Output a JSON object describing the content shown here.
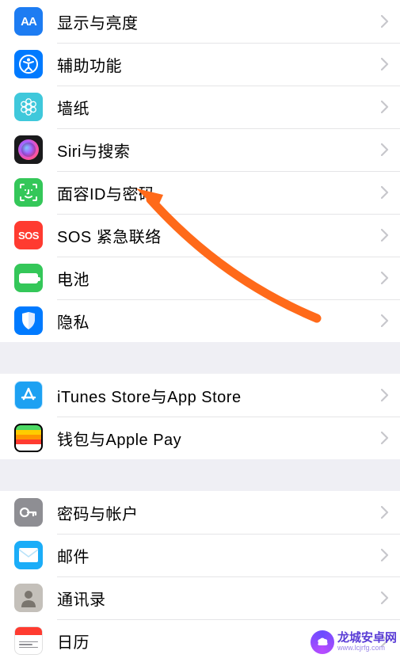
{
  "groups": [
    {
      "items": [
        {
          "key": "display",
          "label": "显示与亮度"
        },
        {
          "key": "access",
          "label": "辅助功能"
        },
        {
          "key": "wallpaper",
          "label": "墙纸"
        },
        {
          "key": "siri",
          "label": "Siri与搜索"
        },
        {
          "key": "faceid",
          "label": "面容ID与密码"
        },
        {
          "key": "sos",
          "label": "SOS 紧急联络"
        },
        {
          "key": "battery",
          "label": "电池"
        },
        {
          "key": "privacy",
          "label": "隐私"
        }
      ]
    },
    {
      "items": [
        {
          "key": "appstore",
          "label": "iTunes Store与App Store"
        },
        {
          "key": "wallet",
          "label": "钱包与Apple Pay"
        }
      ]
    },
    {
      "items": [
        {
          "key": "passwords",
          "label": "密码与帐户"
        },
        {
          "key": "mail",
          "label": "邮件"
        },
        {
          "key": "contacts",
          "label": "通讯录"
        },
        {
          "key": "calendar",
          "label": "日历"
        }
      ]
    }
  ],
  "icons": {
    "display_text": "AA",
    "sos_text": "SOS"
  },
  "watermark": {
    "title": "龙城安卓网",
    "url": "www.lcjrfg.com"
  },
  "colors": {
    "wallet_stripes": [
      "#4cd964",
      "#ffcc00",
      "#ff9500",
      "#ff3b30",
      "#fff"
    ]
  }
}
